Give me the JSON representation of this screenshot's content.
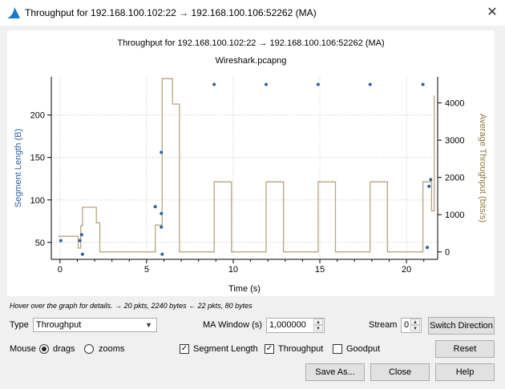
{
  "window": {
    "title": "Throughput for 192.168.100.102:22 → 192.168.100.106:52262 (MA)",
    "close_icon": "close-icon"
  },
  "plot": {
    "title": "Throughput for 192.168.100.102:22 → 192.168.100.106:52262 (MA)",
    "subtitle": "Wireshark.pcapng"
  },
  "chart_data": {
    "type": "scatter",
    "title": "Throughput for 192.168.100.102:22 → 192.168.100.106:52262 (MA)",
    "subtitle": "Wireshark.pcapng",
    "xlabel": "Time (s)",
    "ylabel": "Segment Length (B)",
    "y2label": "Average Throughput (bits/s)",
    "xlim": [
      -0.5,
      21.8
    ],
    "ylim": [
      30,
      245
    ],
    "y2lim": [
      -200,
      4700
    ],
    "xticks": [
      0,
      5,
      10,
      15,
      20
    ],
    "yticks": [
      50,
      100,
      150,
      200
    ],
    "y2ticks": [
      0,
      1000,
      2000,
      3000,
      4000
    ],
    "grid": true,
    "colors": {
      "segment": "#3060a0",
      "throughput": "#b5a680"
    },
    "series": [
      {
        "name": "Segment Length",
        "type": "scatter",
        "axis": "left",
        "points": [
          [
            0.05,
            52
          ],
          [
            1.15,
            52
          ],
          [
            1.25,
            59
          ],
          [
            1.3,
            36
          ],
          [
            5.5,
            92
          ],
          [
            5.85,
            84
          ],
          [
            5.85,
            156
          ],
          [
            5.85,
            68
          ],
          [
            5.9,
            36
          ],
          [
            8.9,
            236
          ],
          [
            11.9,
            236
          ],
          [
            14.9,
            236
          ],
          [
            17.9,
            236
          ],
          [
            20.95,
            236
          ],
          [
            21.2,
            44
          ],
          [
            21.3,
            116
          ],
          [
            21.4,
            124
          ]
        ]
      },
      {
        "name": "Throughput",
        "type": "step",
        "axis": "right",
        "points": [
          [
            -0.1,
            420
          ],
          [
            1.05,
            420
          ],
          [
            1.05,
            100
          ],
          [
            1.2,
            100
          ],
          [
            1.2,
            700
          ],
          [
            1.3,
            700
          ],
          [
            1.3,
            1200
          ],
          [
            2.1,
            1200
          ],
          [
            2.1,
            780
          ],
          [
            2.3,
            780
          ],
          [
            2.3,
            0
          ],
          [
            5.5,
            0
          ],
          [
            5.5,
            720
          ],
          [
            5.9,
            720
          ],
          [
            5.9,
            4650
          ],
          [
            6.5,
            4650
          ],
          [
            6.5,
            3970
          ],
          [
            6.9,
            3970
          ],
          [
            6.9,
            0
          ],
          [
            8.9,
            0
          ],
          [
            8.9,
            1880
          ],
          [
            9.9,
            1880
          ],
          [
            9.9,
            0
          ],
          [
            11.9,
            0
          ],
          [
            11.9,
            1880
          ],
          [
            12.9,
            1880
          ],
          [
            12.9,
            0
          ],
          [
            14.9,
            0
          ],
          [
            14.9,
            1880
          ],
          [
            15.9,
            1880
          ],
          [
            15.9,
            0
          ],
          [
            17.9,
            0
          ],
          [
            17.9,
            1880
          ],
          [
            18.9,
            1880
          ],
          [
            18.9,
            0
          ],
          [
            20.95,
            0
          ],
          [
            20.95,
            1880
          ],
          [
            21.45,
            1880
          ],
          [
            21.45,
            1100
          ],
          [
            21.6,
            1100
          ],
          [
            21.6,
            4200
          ]
        ]
      }
    ]
  },
  "status": {
    "hint": "Hover over the graph for details. → 20 pkts, 2240 bytes ← 22 pkts, 80 bytes"
  },
  "controls": {
    "type_label": "Type",
    "type_value": "Throughput",
    "ma_window_label": "MA Window (s)",
    "ma_window_value": "1,000000",
    "stream_label": "Stream",
    "stream_value": "0",
    "switch_direction_label": "Switch Direction",
    "mouse_label": "Mouse",
    "drags_label": "drags",
    "zooms_label": "zooms",
    "segment_length_label": "Segment Length",
    "throughput_label": "Throughput",
    "goodput_label": "Goodput",
    "reset_label": "Reset",
    "save_as_label": "Save As...",
    "close_label": "Close",
    "help_label": "Help"
  }
}
